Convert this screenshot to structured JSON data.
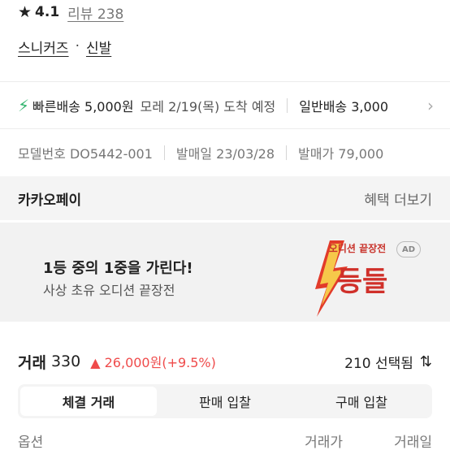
{
  "rating": {
    "value": "4.1",
    "review_label": "리뷰 238",
    "icon": "star-icon"
  },
  "category": {
    "item1": "스니커즈",
    "separator": "·",
    "item2": "신발"
  },
  "shipping": {
    "fast_label": "빠른배송 5,000원",
    "fast_date": "모레 2/19(목) 도착 예정",
    "normal_label": "일반배송 3,000",
    "accent_color": "#31b46e"
  },
  "info": {
    "model": "모델번호 DO5442-001",
    "release": "발매일 23/03/28",
    "price": "발매가 79,000"
  },
  "payment": {
    "title": "카카오페이",
    "more": "혜택 더보기"
  },
  "banner": {
    "title": "1등 중의 1중을 가린다!",
    "subtitle": "사상 초유 오디션 끝장전",
    "ad_badge": "AD",
    "art_top": "오디션 끝장전",
    "art_main": "등들"
  },
  "trade": {
    "label": "거래",
    "count": "330",
    "change": "▲ 26,000원(+9.5%)",
    "change_color": "#ef4b4b",
    "selected": "210 선택됨",
    "sort_icon": "sort-icon"
  },
  "tabs": [
    {
      "label": "체결 거래",
      "active": true
    },
    {
      "label": "판매 입찰",
      "active": false
    },
    {
      "label": "구매 입찰",
      "active": false
    }
  ],
  "table": {
    "columns": [
      "옵션",
      "거래가",
      "거래일"
    ]
  }
}
